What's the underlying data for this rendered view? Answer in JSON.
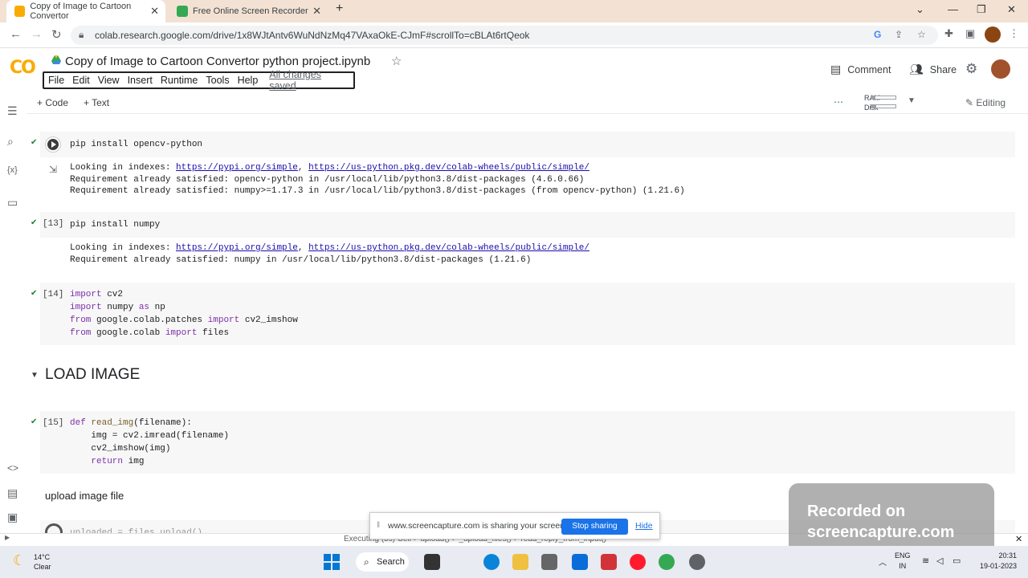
{
  "browser": {
    "tabs": [
      {
        "title": "Copy of Image to Cartoon Convertor",
        "active": true
      },
      {
        "title": "Free Online Screen Recorder",
        "active": false
      }
    ],
    "new_tab": "+",
    "url": "colab.research.google.com/drive/1x8WJtAntv6WuNdNzMq47VAxaOkE-CJmF#scrollTo=cBLAt6rtQeok"
  },
  "colab": {
    "logo": "CO",
    "title": "Copy of Image to Cartoon Convertor python project.ipynb",
    "menu": [
      "File",
      "Edit",
      "View",
      "Insert",
      "Runtime",
      "Tools",
      "Help"
    ],
    "saved_status": "All changes saved",
    "comment": "Comment",
    "share": "Share",
    "add_code": "+ Code",
    "add_text": "+ Text",
    "ram_label": "RAM",
    "disk_label": "Disk",
    "ram_fraction": 0.15,
    "disk_fraction": 0.2,
    "mode": "Editing"
  },
  "cells": {
    "c1": {
      "code": "pip install opencv-python",
      "output": [
        "Looking in indexes: ",
        "https://pypi.org/simple",
        ", ",
        "https://us-python.pkg.dev/colab-wheels/public/simple/",
        "Requirement already satisfied: opencv-python in /usr/local/lib/python3.8/dist-packages (4.6.0.66)",
        "Requirement already satisfied: numpy>=1.17.3 in /usr/local/lib/python3.8/dist-packages (from opencv-python) (1.21.6)"
      ]
    },
    "c2": {
      "exec": "[13]",
      "code": "pip install numpy",
      "output": [
        "Looking in indexes: ",
        "https://pypi.org/simple",
        ", ",
        "https://us-python.pkg.dev/colab-wheels/public/simple/",
        "Requirement already satisfied: numpy in /usr/local/lib/python3.8/dist-packages (1.21.6)"
      ]
    },
    "c3": {
      "exec": "[14]",
      "lines": [
        "import",
        " cv2",
        "import",
        " numpy ",
        "as",
        " np",
        "from",
        " google.colab.patches ",
        "import",
        " cv2_imshow",
        "from",
        " google.colab ",
        "import",
        " files"
      ]
    },
    "section": "LOAD IMAGE",
    "c4": {
      "exec": "[15]",
      "lines": [
        "def",
        "read_img",
        "(filename):",
        "img = cv2.imread(filename)",
        "cv2_imshow(img)",
        "return",
        " img"
      ]
    },
    "upload_text": "upload image file",
    "partial_code": "uploaded = files.upload()"
  },
  "status": {
    "executing": "Executing (5s) Cell > upload() > _upload_files() > read_reply_from_input()"
  },
  "share_banner": {
    "text": "www.screencapture.com is sharing your screen.",
    "stop": "Stop sharing",
    "hide": "Hide"
  },
  "watermark": {
    "line1": "Recorded on",
    "line2": "screencapture.com"
  },
  "taskbar": {
    "weather_temp": "14°C",
    "weather_desc": "Clear",
    "search": "Search",
    "lang1": "ENG",
    "lang2": "IN",
    "time": "20:31",
    "date": "19-01-2023"
  }
}
